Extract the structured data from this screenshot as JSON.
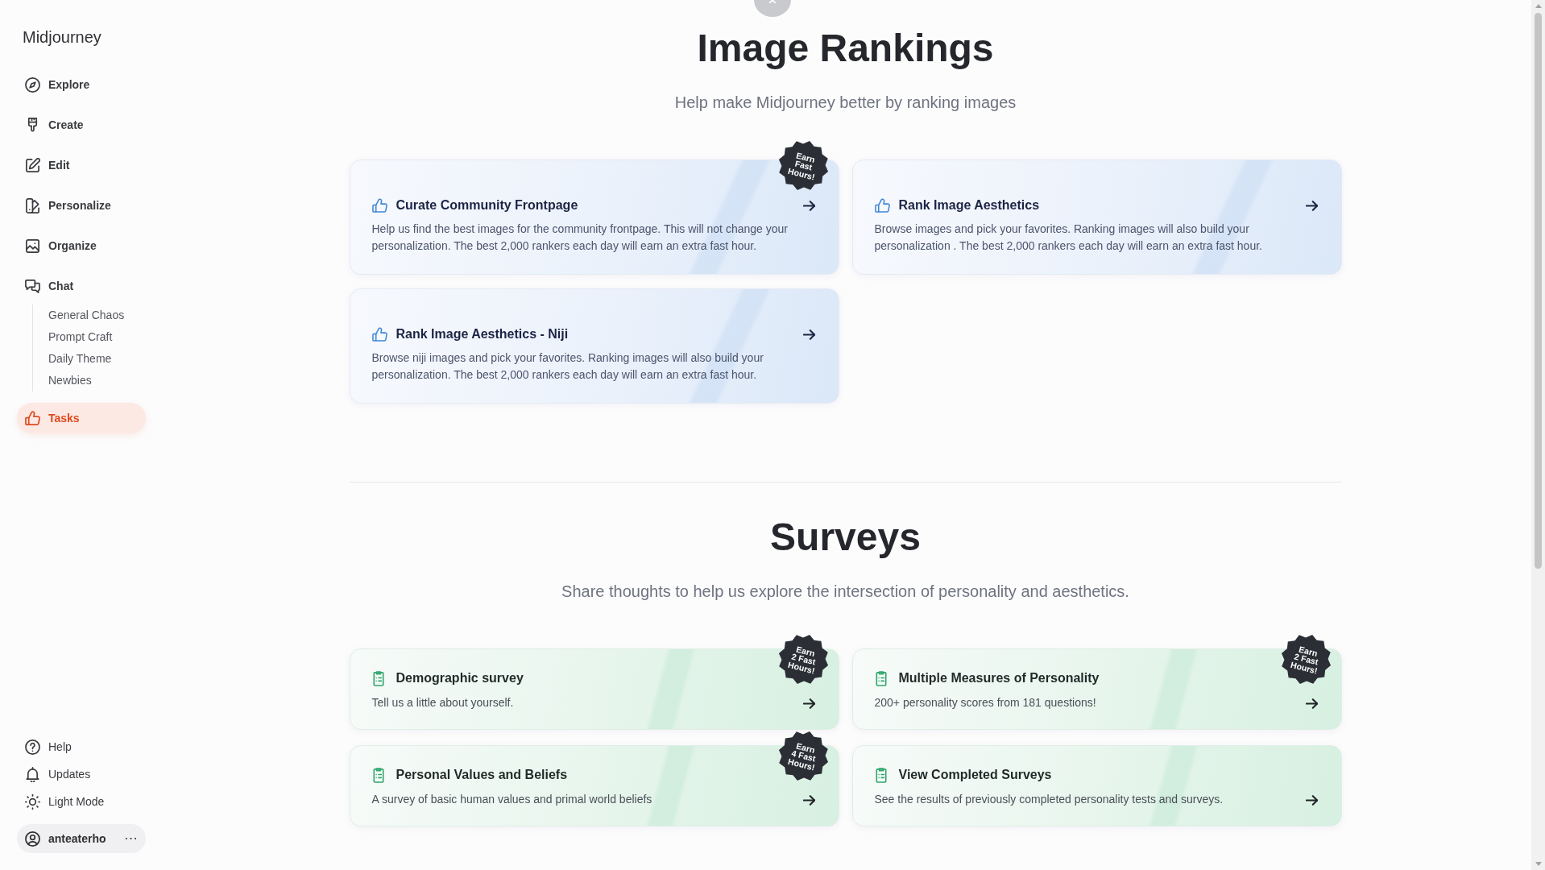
{
  "sidebar": {
    "logo": "Midjourney",
    "nav": [
      {
        "label": "Explore",
        "selected": false
      },
      {
        "label": "Create",
        "selected": false
      },
      {
        "label": "Edit",
        "selected": false
      },
      {
        "label": "Personalize",
        "selected": false
      },
      {
        "label": "Organize",
        "selected": false
      },
      {
        "label": "Chat",
        "selected": false,
        "children": [
          {
            "label": "General Chaos",
            "selected": false
          },
          {
            "label": "Prompt Craft",
            "selected": false
          },
          {
            "label": "Daily Theme",
            "selected": false
          },
          {
            "label": "Newbies",
            "selected": false
          }
        ]
      },
      {
        "label": "Tasks",
        "selected": true
      }
    ],
    "footer": [
      {
        "label": "Help"
      },
      {
        "label": "Updates"
      },
      {
        "label": "Light Mode"
      }
    ],
    "account": {
      "username": "anteaterho"
    }
  },
  "rankings": {
    "title": "Image Rankings",
    "subtitle": "Help make Midjourney better by ranking images",
    "cards": [
      {
        "title": "Curate Community Frontpage",
        "description": "Help us find the best images for the community frontpage. This will not change your personalization. The best 2,000 rankers each day will earn an extra fast hour.",
        "badge": "Earn\nFast\nHours!"
      },
      {
        "title": "Rank Image Aesthetics",
        "description": "Browse images and pick your favorites. Ranking images will also build your personalization . The best 2,000 rankers each day will earn an extra fast hour."
      },
      {
        "title": "Rank Image Aesthetics - Niji",
        "description": "Browse niji images and pick your favorites. Ranking images will also build your personalization. The best 2,000 rankers each day will earn an extra fast hour."
      }
    ]
  },
  "surveys": {
    "title": "Surveys",
    "subtitle": "Share thoughts to help us explore the intersection of personality and aesthetics.",
    "cards": [
      {
        "title": "Demographic survey",
        "description": "Tell us a little about yourself.",
        "badge": "Earn\n2 Fast\nHours!"
      },
      {
        "title": "Multiple Measures of Personality",
        "description": "200+ personality scores from 181 questions!",
        "badge": "Earn\n2 Fast\nHours!"
      },
      {
        "title": "Personal Values and Beliefs",
        "description": "A survey of basic human values and primal world beliefs",
        "badge": "Earn\n4 Fast\nHours!"
      },
      {
        "title": "View Completed Surveys",
        "description": "See the results of previously completed personality tests and surveys."
      }
    ]
  }
}
